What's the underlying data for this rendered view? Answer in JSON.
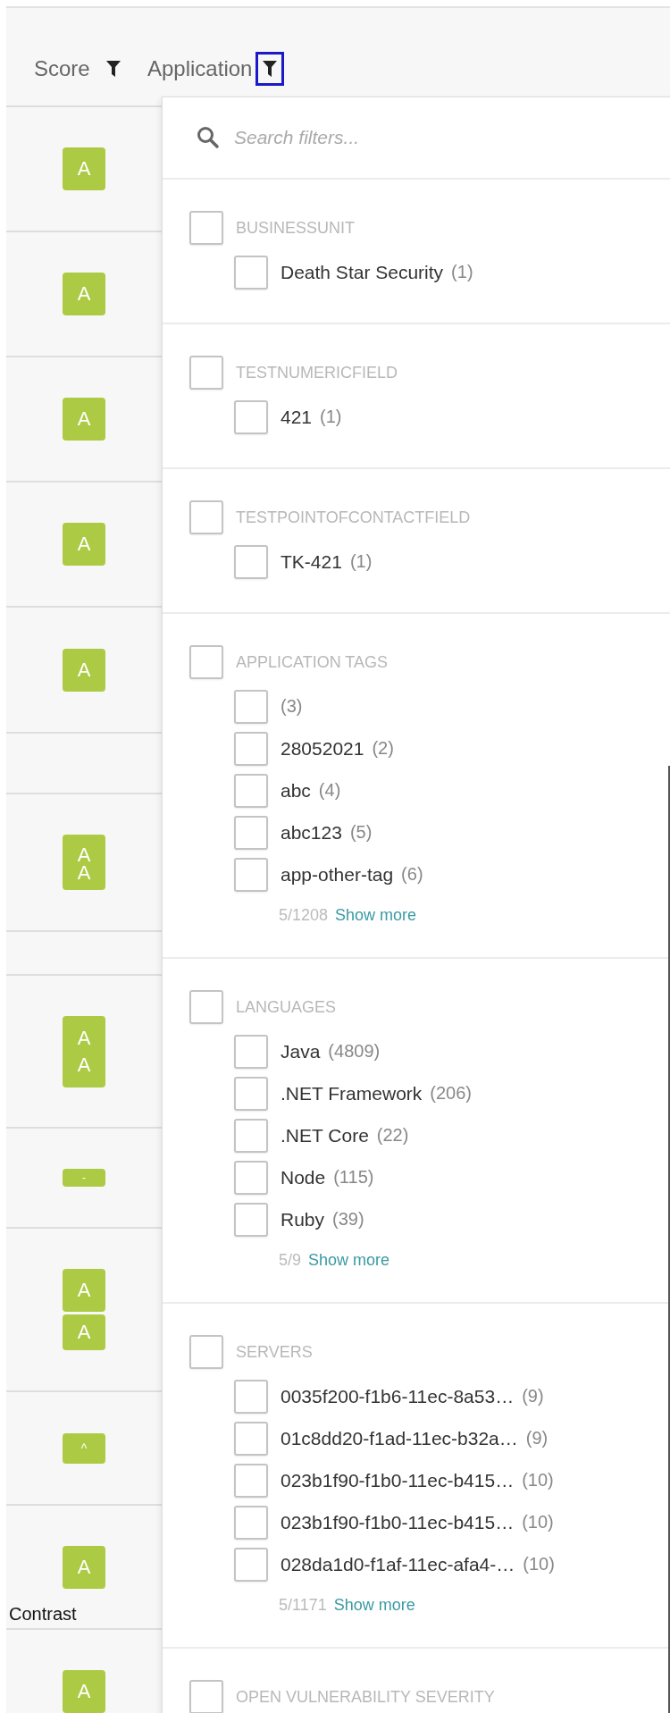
{
  "table": {
    "columns": [
      {
        "label": "Score",
        "focused": false
      },
      {
        "label": "Application",
        "focused": true
      }
    ],
    "rows": [
      {
        "kind": "single",
        "grades": [
          "A"
        ]
      },
      {
        "kind": "single",
        "grades": [
          "A"
        ]
      },
      {
        "kind": "single",
        "grades": [
          "A"
        ]
      },
      {
        "kind": "single",
        "grades": [
          "A"
        ]
      },
      {
        "kind": "single",
        "grades": [
          "A"
        ]
      },
      {
        "kind": "empty"
      },
      {
        "kind": "overlap",
        "grades": [
          "A",
          "A"
        ]
      },
      {
        "kind": "empty"
      },
      {
        "kind": "stacked",
        "grades": [
          "A",
          "A"
        ]
      },
      {
        "kind": "tiny",
        "grades": [
          "-"
        ]
      },
      {
        "kind": "double",
        "grades": [
          "A",
          "A"
        ]
      },
      {
        "kind": "small",
        "grades": [
          "^"
        ]
      },
      {
        "kind": "single",
        "grades": [
          "A"
        ],
        "note": "Contrast"
      },
      {
        "kind": "single",
        "grades": [
          "A"
        ]
      }
    ]
  },
  "filter_panel": {
    "search": {
      "placeholder": "Search filters..."
    },
    "groups": [
      {
        "title": "BUSINESSUNIT",
        "checked": false,
        "options": [
          {
            "label": "Death Star Security",
            "count": "(1)",
            "checked": false
          }
        ]
      },
      {
        "title": "TESTNUMERICFIELD",
        "checked": false,
        "options": [
          {
            "label": "421",
            "count": "(1)",
            "checked": false
          }
        ]
      },
      {
        "title": "TESTPOINTOFCONTACTFIELD",
        "checked": false,
        "options": [
          {
            "label": "TK-421",
            "count": "(1)",
            "checked": false
          }
        ]
      },
      {
        "title": "APPLICATION TAGS",
        "checked": false,
        "options": [
          {
            "count": "(3)",
            "checked": false
          },
          {
            "label": "28052021",
            "count": "(2)",
            "checked": false
          },
          {
            "label": "abc",
            "count": "(4)",
            "checked": false
          },
          {
            "label": "abc123",
            "count": "(5)",
            "checked": false
          },
          {
            "label": "app-other-tag",
            "count": "(6)",
            "checked": false
          }
        ],
        "shown": "5/1208",
        "more": "Show more"
      },
      {
        "title": "LANGUAGES",
        "checked": false,
        "options": [
          {
            "label": "Java",
            "count": "(4809)",
            "checked": false
          },
          {
            "label": ".NET Framework",
            "count": "(206)",
            "checked": false
          },
          {
            "label": ".NET Core",
            "count": "(22)",
            "checked": false
          },
          {
            "label": "Node",
            "count": "(115)",
            "checked": false
          },
          {
            "label": "Ruby",
            "count": "(39)",
            "checked": false
          }
        ],
        "shown": "5/9",
        "more": "Show more"
      },
      {
        "title": "SERVERS",
        "checked": false,
        "options": [
          {
            "label": "0035f200-f1b6-11ec-8a53…",
            "count": "(9)",
            "checked": false
          },
          {
            "label": "01c8dd20-f1ad-11ec-b32a…",
            "count": "(9)",
            "checked": false
          },
          {
            "label": "023b1f90-f1b0-11ec-b415…",
            "count": "(10)",
            "checked": false
          },
          {
            "label": "023b1f90-f1b0-11ec-b415…",
            "count": "(10)",
            "checked": false
          },
          {
            "label": "028da1d0-f1af-11ec-afa4-…",
            "count": "(10)",
            "checked": false
          }
        ],
        "shown": "5/1171",
        "more": "Show more"
      },
      {
        "title": "OPEN VULNERABILITY SEVERITY",
        "checked": false
      }
    ]
  }
}
